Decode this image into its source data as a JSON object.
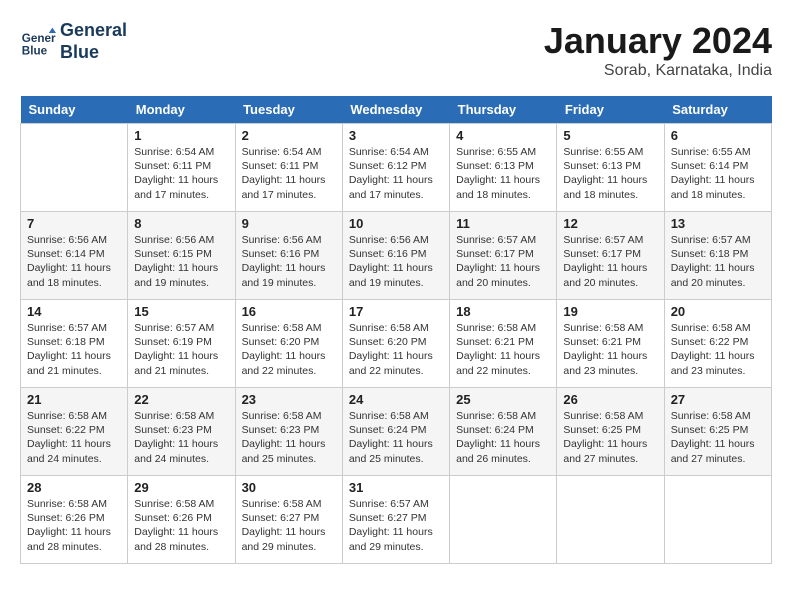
{
  "header": {
    "logo_line1": "General",
    "logo_line2": "Blue",
    "month": "January 2024",
    "location": "Sorab, Karnataka, India"
  },
  "days_of_week": [
    "Sunday",
    "Monday",
    "Tuesday",
    "Wednesday",
    "Thursday",
    "Friday",
    "Saturday"
  ],
  "weeks": [
    [
      {
        "num": "",
        "info": ""
      },
      {
        "num": "1",
        "info": "Sunrise: 6:54 AM\nSunset: 6:11 PM\nDaylight: 11 hours and 17 minutes."
      },
      {
        "num": "2",
        "info": "Sunrise: 6:54 AM\nSunset: 6:11 PM\nDaylight: 11 hours and 17 minutes."
      },
      {
        "num": "3",
        "info": "Sunrise: 6:54 AM\nSunset: 6:12 PM\nDaylight: 11 hours and 17 minutes."
      },
      {
        "num": "4",
        "info": "Sunrise: 6:55 AM\nSunset: 6:13 PM\nDaylight: 11 hours and 18 minutes."
      },
      {
        "num": "5",
        "info": "Sunrise: 6:55 AM\nSunset: 6:13 PM\nDaylight: 11 hours and 18 minutes."
      },
      {
        "num": "6",
        "info": "Sunrise: 6:55 AM\nSunset: 6:14 PM\nDaylight: 11 hours and 18 minutes."
      }
    ],
    [
      {
        "num": "7",
        "info": "Sunrise: 6:56 AM\nSunset: 6:14 PM\nDaylight: 11 hours and 18 minutes."
      },
      {
        "num": "8",
        "info": "Sunrise: 6:56 AM\nSunset: 6:15 PM\nDaylight: 11 hours and 19 minutes."
      },
      {
        "num": "9",
        "info": "Sunrise: 6:56 AM\nSunset: 6:16 PM\nDaylight: 11 hours and 19 minutes."
      },
      {
        "num": "10",
        "info": "Sunrise: 6:56 AM\nSunset: 6:16 PM\nDaylight: 11 hours and 19 minutes."
      },
      {
        "num": "11",
        "info": "Sunrise: 6:57 AM\nSunset: 6:17 PM\nDaylight: 11 hours and 20 minutes."
      },
      {
        "num": "12",
        "info": "Sunrise: 6:57 AM\nSunset: 6:17 PM\nDaylight: 11 hours and 20 minutes."
      },
      {
        "num": "13",
        "info": "Sunrise: 6:57 AM\nSunset: 6:18 PM\nDaylight: 11 hours and 20 minutes."
      }
    ],
    [
      {
        "num": "14",
        "info": "Sunrise: 6:57 AM\nSunset: 6:18 PM\nDaylight: 11 hours and 21 minutes."
      },
      {
        "num": "15",
        "info": "Sunrise: 6:57 AM\nSunset: 6:19 PM\nDaylight: 11 hours and 21 minutes."
      },
      {
        "num": "16",
        "info": "Sunrise: 6:58 AM\nSunset: 6:20 PM\nDaylight: 11 hours and 22 minutes."
      },
      {
        "num": "17",
        "info": "Sunrise: 6:58 AM\nSunset: 6:20 PM\nDaylight: 11 hours and 22 minutes."
      },
      {
        "num": "18",
        "info": "Sunrise: 6:58 AM\nSunset: 6:21 PM\nDaylight: 11 hours and 22 minutes."
      },
      {
        "num": "19",
        "info": "Sunrise: 6:58 AM\nSunset: 6:21 PM\nDaylight: 11 hours and 23 minutes."
      },
      {
        "num": "20",
        "info": "Sunrise: 6:58 AM\nSunset: 6:22 PM\nDaylight: 11 hours and 23 minutes."
      }
    ],
    [
      {
        "num": "21",
        "info": "Sunrise: 6:58 AM\nSunset: 6:22 PM\nDaylight: 11 hours and 24 minutes."
      },
      {
        "num": "22",
        "info": "Sunrise: 6:58 AM\nSunset: 6:23 PM\nDaylight: 11 hours and 24 minutes."
      },
      {
        "num": "23",
        "info": "Sunrise: 6:58 AM\nSunset: 6:23 PM\nDaylight: 11 hours and 25 minutes."
      },
      {
        "num": "24",
        "info": "Sunrise: 6:58 AM\nSunset: 6:24 PM\nDaylight: 11 hours and 25 minutes."
      },
      {
        "num": "25",
        "info": "Sunrise: 6:58 AM\nSunset: 6:24 PM\nDaylight: 11 hours and 26 minutes."
      },
      {
        "num": "26",
        "info": "Sunrise: 6:58 AM\nSunset: 6:25 PM\nDaylight: 11 hours and 27 minutes."
      },
      {
        "num": "27",
        "info": "Sunrise: 6:58 AM\nSunset: 6:25 PM\nDaylight: 11 hours and 27 minutes."
      }
    ],
    [
      {
        "num": "28",
        "info": "Sunrise: 6:58 AM\nSunset: 6:26 PM\nDaylight: 11 hours and 28 minutes."
      },
      {
        "num": "29",
        "info": "Sunrise: 6:58 AM\nSunset: 6:26 PM\nDaylight: 11 hours and 28 minutes."
      },
      {
        "num": "30",
        "info": "Sunrise: 6:58 AM\nSunset: 6:27 PM\nDaylight: 11 hours and 29 minutes."
      },
      {
        "num": "31",
        "info": "Sunrise: 6:57 AM\nSunset: 6:27 PM\nDaylight: 11 hours and 29 minutes."
      },
      {
        "num": "",
        "info": ""
      },
      {
        "num": "",
        "info": ""
      },
      {
        "num": "",
        "info": ""
      }
    ]
  ]
}
